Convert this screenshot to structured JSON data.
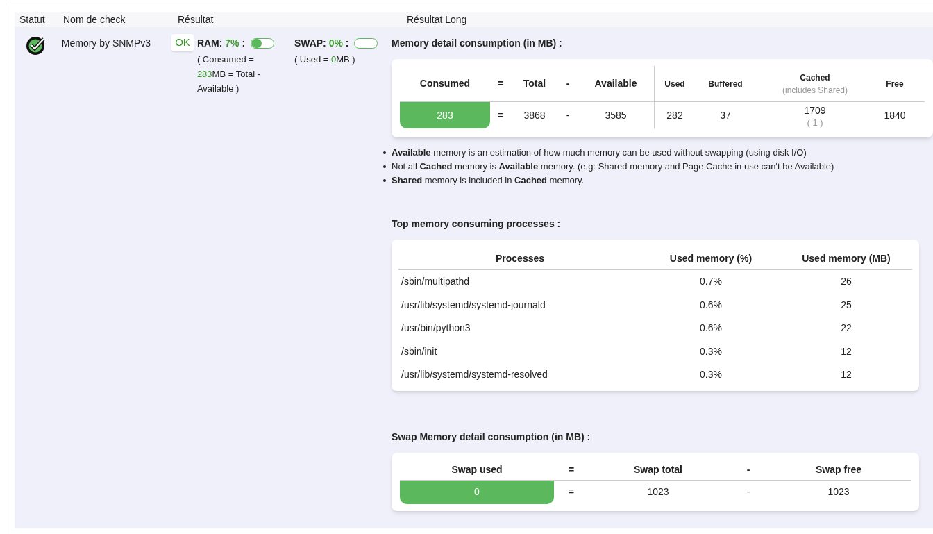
{
  "table": {
    "columns": [
      "Statut",
      "Nom de check",
      "Résultat",
      "Résultat Long"
    ],
    "row": {
      "kind": "ok",
      "check_name": "Memory by SNMPv3",
      "state_badge": "OK",
      "ram": {
        "label": "RAM:",
        "percent": "7%",
        "suffix": ":",
        "level": 0.45,
        "detail_prefix": "( Consumed =",
        "detail_value": "283",
        "detail_suffix": "MB = Total - Available )"
      },
      "swap": {
        "label": "SWAP:",
        "percent": "0%",
        "suffix": ":",
        "level": 0,
        "detail_prefix": "( Used =",
        "detail_value": "0",
        "detail_suffix": "MB )"
      },
      "memory_title": "Memory detail consumption (in MB) :",
      "memory_table": {
        "main_headers": [
          "Consumed",
          "=",
          "Total",
          "-",
          "Available"
        ],
        "detail_headers": [
          {
            "label": "Used"
          },
          {
            "label": "Buffered"
          },
          {
            "label": "Cached",
            "sub": "(includes Shared)"
          },
          {
            "label": "Free"
          }
        ],
        "main_values": [
          "283",
          "=",
          "3868",
          "-",
          "3585"
        ],
        "detail_values": [
          {
            "value": "282"
          },
          {
            "value": "37"
          },
          {
            "value": "1709",
            "sub": "( 1 )"
          },
          {
            "value": "1840"
          }
        ]
      },
      "notes": [
        "**Available** memory is an estimation of how much memory can be used without swapping (using disk I/O)",
        "Not all **Cached** memory is **Available** memory. (e.g: Shared memory and Page Cache in use can't be Available)",
        "**Shared** memory is included in **Cached** memory."
      ],
      "processes_title": "Top memory consuming processes :",
      "processes": {
        "columns": [
          "Processes",
          "Used memory (%)",
          "Used memory (MB)"
        ],
        "rows": [
          [
            "/sbin/multipathd",
            "0.7%",
            "26"
          ],
          [
            "/usr/lib/systemd/systemd-journald",
            "0.6%",
            "25"
          ],
          [
            "/usr/bin/python3",
            "0.6%",
            "22"
          ],
          [
            "/sbin/init",
            "0.3%",
            "12"
          ],
          [
            "/usr/lib/systemd/systemd-resolved",
            "0.3%",
            "12"
          ]
        ]
      },
      "swap_title": "Swap Memory detail consumption (in MB) :",
      "swap_table": {
        "headers": [
          "Swap used",
          "=",
          "Swap total",
          "-",
          "Swap free"
        ],
        "values": [
          "0",
          "=",
          "1023",
          "-",
          "1023"
        ]
      }
    }
  }
}
